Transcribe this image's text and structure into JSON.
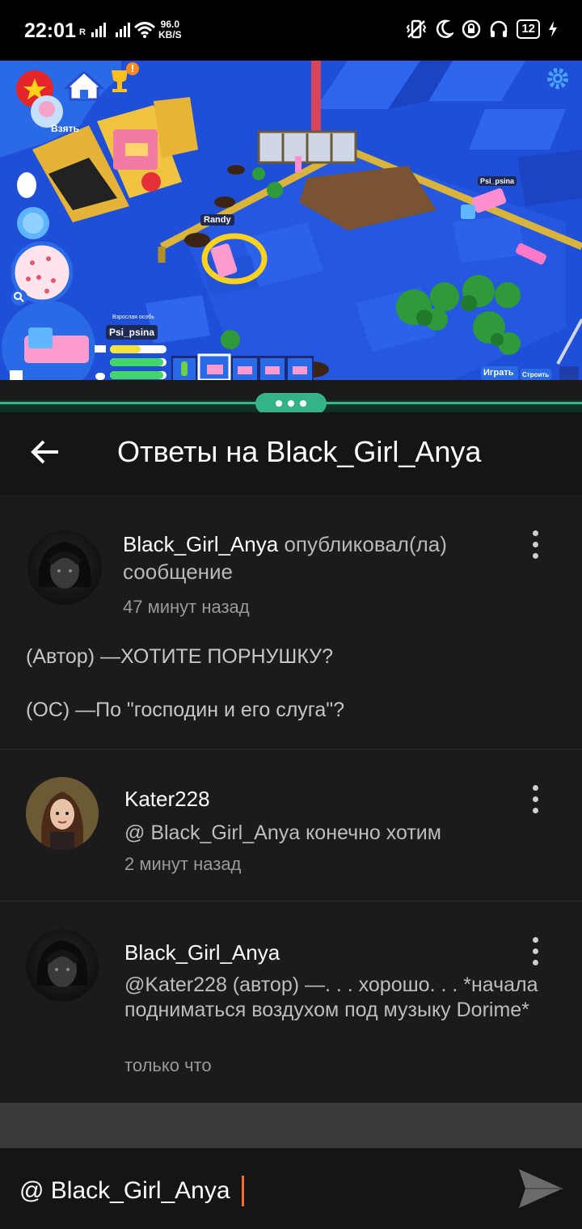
{
  "status_bar": {
    "time": "22:01",
    "signal_letter": "R",
    "net_speed_value": "96.0",
    "net_speed_unit": "KB/S",
    "battery": "12"
  },
  "game": {
    "take_label": "Взять",
    "npc_name": "Randy",
    "pet_name_1": "Psi_psina",
    "pet_name_2": "Psi_psina",
    "pet_stage": "Взрослая особь",
    "play_button": "Играть",
    "build_button": "Строить",
    "stat_icons": [
      "food-icon",
      "sleep-icon",
      "toy-icon"
    ],
    "colors": {
      "floor": "#1f4fd6",
      "floor_light": "#3a7bff",
      "rail": "#d9b33a"
    }
  },
  "header": {
    "title": "Ответы на Black_Girl_Anya"
  },
  "posts": [
    {
      "author": "Black_Girl_Anya",
      "action": "опубликовал(ла)",
      "action2": "сообщение",
      "time": "47 минут назад",
      "body_line1": "(Автор) —ХОТИТЕ ПОРНУШКУ?",
      "body_line2": "(ОС) —По \"господин и его слуга\"?"
    },
    {
      "author": "Kater228",
      "text": "@ Black_Girl_Anya  конечно хотим",
      "time": "2 минут назад"
    },
    {
      "author": "Black_Girl_Anya",
      "text": "@Kater228 (автор) —. . . хорошо. . . *начала подниматься воздухом под музыку Dorime*",
      "time": "только что"
    }
  ],
  "composer": {
    "value": "@ Black_Girl_Anya"
  },
  "theme": {
    "accent_green": "#34b486",
    "caret_orange": "#ff6a2a",
    "background": "#1b1b1b"
  }
}
